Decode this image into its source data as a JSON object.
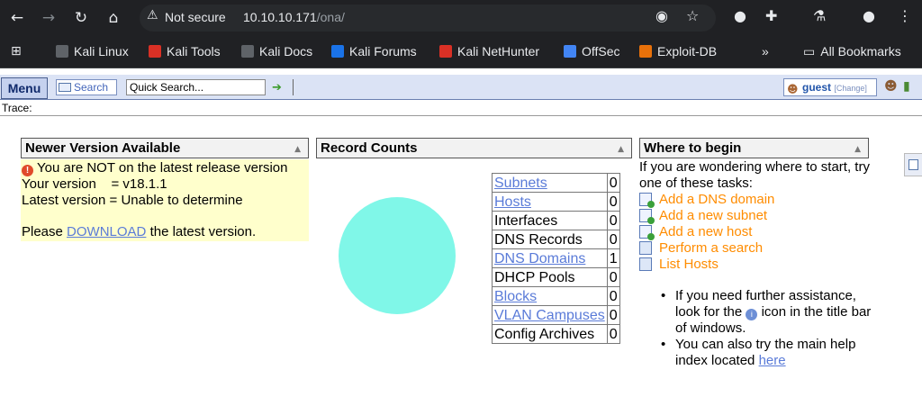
{
  "browser": {
    "security_label": "Not secure",
    "url_host": "10.10.10.171",
    "url_path": "/ona/",
    "bookmarks": [
      {
        "label": "Kali Linux",
        "color": "#5f6368"
      },
      {
        "label": "Kali Tools",
        "color": "#d93025"
      },
      {
        "label": "Kali Docs",
        "color": "#5f6368"
      },
      {
        "label": "Kali Forums",
        "color": "#1a73e8"
      },
      {
        "label": "Kali NetHunter",
        "color": "#d93025"
      },
      {
        "label": "OffSec",
        "color": "#4285f4"
      },
      {
        "label": "Exploit-DB",
        "color": "#e8710a"
      }
    ],
    "overflow_label": "»",
    "all_bookmarks_label": "All Bookmarks"
  },
  "toolbar": {
    "menu_label": "Menu",
    "search_label": "Search",
    "quick_search_value": "Quick Search...",
    "user_name": "guest",
    "change_label": "[Change]"
  },
  "trace": {
    "label": "Trace:"
  },
  "newer_version": {
    "title": "Newer Version Available",
    "warning": "You are NOT on the latest release version",
    "your_version": "Your version    = v18.1.1",
    "latest_version": "Latest version = Unable to determine",
    "please_prefix": "Please",
    "download_link": "DOWNLOAD",
    "please_suffix": "the latest version."
  },
  "record_counts": {
    "title": "Record Counts",
    "rows": [
      {
        "name": "Subnets",
        "count": "0",
        "link": true
      },
      {
        "name": "Hosts",
        "count": "0",
        "link": true
      },
      {
        "name": "Interfaces",
        "count": "0",
        "link": false
      },
      {
        "name": "DNS Records",
        "count": "0",
        "link": false
      },
      {
        "name": "DNS Domains",
        "count": "1",
        "link": true
      },
      {
        "name": "DHCP Pools",
        "count": "0",
        "link": false
      },
      {
        "name": "Blocks",
        "count": "0",
        "link": true
      },
      {
        "name": "VLAN Campuses",
        "count": "0",
        "link": true
      },
      {
        "name": "Config Archives",
        "count": "0",
        "link": false
      }
    ],
    "pie_color": "#80f7e8"
  },
  "where_to_begin": {
    "title": "Where to begin",
    "intro": "If you are wondering where to start, try one of these tasks:",
    "tasks": [
      {
        "label": "Add a DNS domain",
        "icon": "add-document-icon"
      },
      {
        "label": "Add a new subnet",
        "icon": "add-document-icon"
      },
      {
        "label": "Add a new host",
        "icon": "add-document-icon"
      },
      {
        "label": "Perform a search",
        "icon": "search-list-icon"
      },
      {
        "label": "List Hosts",
        "icon": "list-icon"
      }
    ],
    "help1_prefix": "If you need further assistance, look for the",
    "help1_suffix": "icon in the title bar of windows.",
    "help2_prefix": "You can also try the main help index located",
    "help2_link": "here"
  }
}
